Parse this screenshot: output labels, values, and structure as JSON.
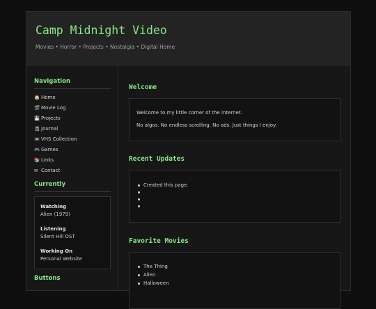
{
  "header": {
    "title": "Camp Midnight Video",
    "tagline": "Movies • Horror • Projects • Nostalgia • Digital Home"
  },
  "sidebar": {
    "nav_heading": "Navigation",
    "nav_items": [
      {
        "icon": "home-icon",
        "glyph": "🏠",
        "label": "Home"
      },
      {
        "icon": "film-icon",
        "glyph": "🎬",
        "label": "Movie Log"
      },
      {
        "icon": "floppy-icon",
        "glyph": "💾",
        "label": "Projects"
      },
      {
        "icon": "notebook-icon",
        "glyph": "📓",
        "label": "Journal"
      },
      {
        "icon": "vhs-icon",
        "glyph": "📼",
        "label": "VHS Collection"
      },
      {
        "icon": "gamepad-icon",
        "glyph": "🎮",
        "label": "Games"
      },
      {
        "icon": "books-icon",
        "glyph": "📚",
        "label": "Links"
      },
      {
        "icon": "mail-icon",
        "glyph": "✉",
        "label": "Contact"
      }
    ],
    "currently_heading": "Currently",
    "currently": [
      {
        "label": "Watching",
        "value": "Alien (1979)"
      },
      {
        "label": "Listening",
        "value": "Silent Hill OST"
      },
      {
        "label": "Working On",
        "value": "Personal Website"
      }
    ],
    "buttons_heading": "Buttons"
  },
  "main": {
    "welcome": {
      "title": "Welcome",
      "line1": "Welcome to my little corner of the internet.",
      "line2": "No algos. No endless scrolling. No ads. Just things I enjoy."
    },
    "updates": {
      "title": "Recent Updates",
      "items": [
        "Created this page.",
        "",
        "",
        ""
      ]
    },
    "favorites": {
      "title": "Favorite Movies",
      "items": [
        "The Thing",
        "Alien",
        "Halloween"
      ]
    }
  },
  "colors": {
    "accent": "#86e886",
    "background": "#0f0f0f",
    "panel": "#171717"
  }
}
